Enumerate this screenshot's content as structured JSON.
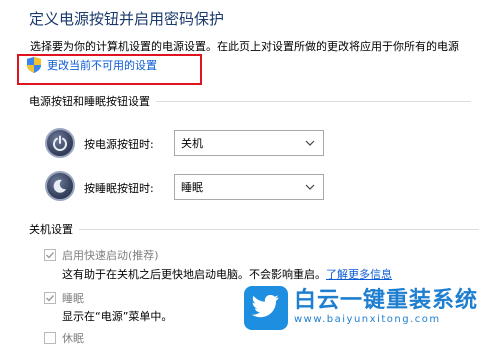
{
  "page": {
    "title": "定义电源按钮并启用密码保护",
    "description": "选择要为你的计算机设置的电源设置。在此页上对设置所做的更改将应用于你所有的电源",
    "change_settings_link": "更改当前不可用的设置"
  },
  "buttons_section": {
    "heading": "电源按钮和睡眠按钮设置",
    "rows": [
      {
        "label": "按电源按钮时:",
        "value": "关机",
        "icon": "power-icon"
      },
      {
        "label": "按睡眠按钮时:",
        "value": "睡眠",
        "icon": "sleep-icon"
      }
    ]
  },
  "shutdown_section": {
    "heading": "关机设置",
    "items": [
      {
        "label": "启用快速启动(推荐)",
        "checked": true,
        "desc": "这有助于在关机之后更快地启动电脑。不会影响重启。",
        "link": "了解更多信息"
      },
      {
        "label": "睡眠",
        "checked": true,
        "desc": "显示在“电源”菜单中。"
      },
      {
        "label": "休眠",
        "checked": false
      }
    ]
  },
  "watermark": {
    "title": "白云一键重装系统",
    "url": "www.baiyunxitong.com"
  },
  "colors": {
    "title": "#1a3a6c",
    "link": "#0b5bd3",
    "highlight": "#e0141e",
    "watermark": "#1e7fd0"
  }
}
